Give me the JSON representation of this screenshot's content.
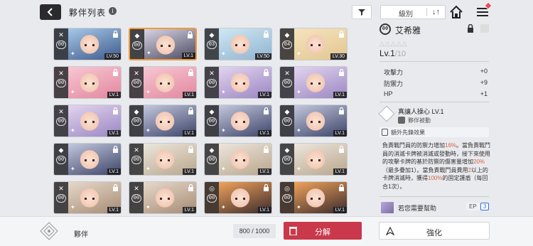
{
  "header": {
    "title": "夥伴列表",
    "info_icon": "i",
    "sort_label": "級別",
    "sort_dir_icon": "↓↑"
  },
  "cards": [
    {
      "num": "00",
      "lv": "LV.50",
      "rank": "✕",
      "colors": [
        "#a6c8e8",
        "#3d5a8a"
      ],
      "locked": true
    },
    {
      "num": "00",
      "lv": "LV.1",
      "rank": "◆",
      "colors": [
        "#d8d5e4",
        "#4d4b63"
      ],
      "locked": true,
      "selected": true
    },
    {
      "num": "03",
      "lv": "LV.50",
      "rank": "◆",
      "colors": [
        "#cfe8f3",
        "#8fb3cf"
      ],
      "locked": true
    },
    {
      "num": "04",
      "lv": "LV.30",
      "rank": "◆",
      "colors": [
        "#f5e3bf",
        "#e3c68f"
      ],
      "locked": true
    },
    {
      "num": "00",
      "lv": "LV.1",
      "rank": "✕",
      "colors": [
        "#f7c7d3",
        "#e2879e"
      ],
      "locked": true
    },
    {
      "num": "00",
      "lv": "LV.1",
      "rank": "✕",
      "colors": [
        "#f7c7d3",
        "#e2879e"
      ],
      "locked": true
    },
    {
      "num": "00",
      "lv": "LV.1",
      "rank": "✕",
      "colors": [
        "#e2d4ef",
        "#9a86c2"
      ],
      "locked": true
    },
    {
      "num": "00",
      "lv": "LV.1",
      "rank": "✕",
      "colors": [
        "#e2d4ef",
        "#9a86c2"
      ],
      "locked": true
    },
    {
      "num": "00",
      "lv": "LV.1",
      "rank": "✕",
      "colors": [
        "#e2d4ef",
        "#9a86c2"
      ],
      "locked": true
    },
    {
      "num": "00",
      "lv": "LV.1",
      "rank": "◆",
      "colors": [
        "#c3c7dd",
        "#3c4468"
      ],
      "locked": true
    },
    {
      "num": "00",
      "lv": "LV.1",
      "rank": "◆",
      "colors": [
        "#c3c7dd",
        "#3c4468"
      ],
      "locked": true
    },
    {
      "num": "00",
      "lv": "LV.1",
      "rank": "◆",
      "colors": [
        "#c3c7dd",
        "#3c4468"
      ],
      "locked": true
    },
    {
      "num": "00",
      "lv": "LV.1",
      "rank": "◆",
      "colors": [
        "#c3c7dd",
        "#3c4468"
      ],
      "locked": true
    },
    {
      "num": "00",
      "lv": "LV.1",
      "rank": "✕",
      "colors": [
        "#ece6dc",
        "#b9a68c"
      ],
      "locked": true
    },
    {
      "num": "00",
      "lv": "LV.1",
      "rank": "◆",
      "colors": [
        "#ece6dc",
        "#b9a68c"
      ],
      "locked": true
    },
    {
      "num": "00",
      "lv": "LV.1",
      "rank": "◆",
      "colors": [
        "#ece6dc",
        "#b9a68c"
      ],
      "locked": true
    },
    {
      "num": "00",
      "lv": "LV.1",
      "rank": "✕",
      "colors": [
        "#e6d8ca",
        "#a68c74"
      ],
      "locked": true
    },
    {
      "num": "00",
      "lv": "LV.1",
      "rank": "✕",
      "colors": [
        "#e6d8ca",
        "#a68c74"
      ],
      "locked": true
    },
    {
      "num": "00",
      "lv": "LV.1",
      "rank": "◎",
      "colors": [
        "#f0a35a",
        "#3a2a2e"
      ],
      "locked": true
    },
    {
      "num": "00",
      "lv": "LV.1",
      "rank": "◎",
      "colors": [
        "#f0a35a",
        "#3a2a2e"
      ],
      "locked": true
    }
  ],
  "panel": {
    "badge": "00",
    "name": "艾希雅",
    "stars": "△△△△△",
    "level": "Lv.1",
    "level_max": "/10",
    "stats": [
      {
        "label": "攻擊力",
        "value": "+0"
      },
      {
        "label": "防禦力",
        "value": "+9"
      },
      {
        "label": "HP",
        "value": "+1"
      }
    ],
    "skill_name": "真讓人操心 LV.1",
    "skill_type": "夥伴被動",
    "extra_label": "額外先鋒效果",
    "desc_parts": [
      {
        "t": "負責戰鬥員的防禦力增加"
      },
      {
        "t": "16%",
        "hl": true
      },
      {
        "t": "。當負責戰鬥員的消滅卡牌被消滅或發動時，接下來使用的攻擊卡牌的基於防禦的傷害量增加"
      },
      {
        "t": "20%",
        "hl": true
      },
      {
        "t": "（最多疊加1）。當負責戰鬥員費用"
      },
      {
        "t": "2",
        "hl": true
      },
      {
        "t": "以上的卡牌消滅時，獲得"
      },
      {
        "t": "100%",
        "hl": true
      },
      {
        "t": "的固定護盾（每回合1次）。"
      }
    ],
    "help_text": "若您需要幫助",
    "ep_label": "EP",
    "ep_value": "3"
  },
  "footer": {
    "label": "夥伴",
    "capacity": "800 / 1000",
    "dismantle_label": "分解",
    "enhance_label": "強化"
  }
}
